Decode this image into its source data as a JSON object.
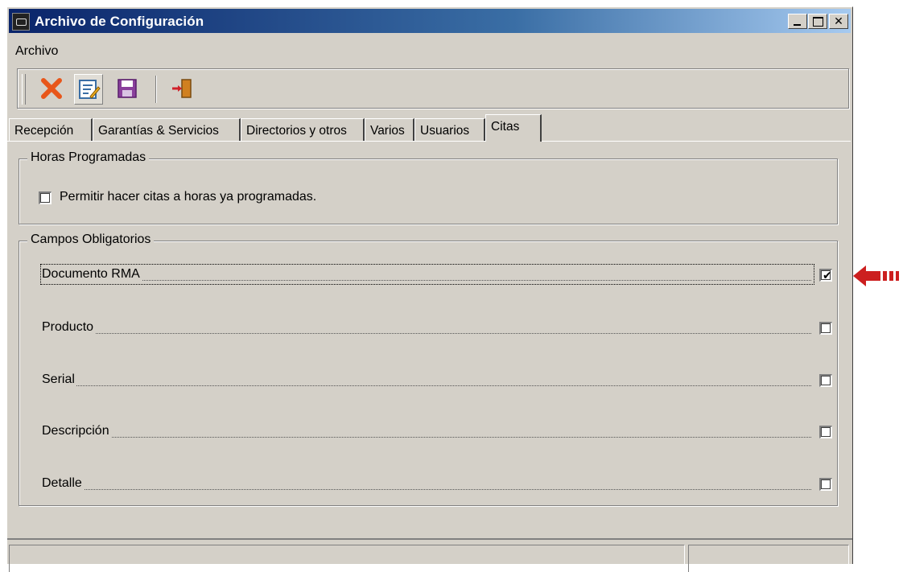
{
  "window": {
    "title": "Archivo de Configuración"
  },
  "menu": {
    "items": [
      "Archivo"
    ]
  },
  "toolbar": {
    "buttons": [
      {
        "icon": "delete-x-icon"
      },
      {
        "icon": "edit-document-icon"
      },
      {
        "icon": "save-disk-icon"
      },
      {
        "icon": "exit-door-icon"
      }
    ]
  },
  "tabs": [
    {
      "label": "Recepción"
    },
    {
      "label": "Garantías & Servicios"
    },
    {
      "label": "Directorios y otros"
    },
    {
      "label": "Varios"
    },
    {
      "label": "Usuarios"
    },
    {
      "label": "Citas",
      "active": true
    }
  ],
  "horas": {
    "legend": "Horas Programadas",
    "checkbox_label": "Permitir hacer citas a horas ya programadas.",
    "checked": false
  },
  "campos": {
    "legend": "Campos Obligatorios",
    "fields": [
      {
        "label": "Documento RMA",
        "checked": true
      },
      {
        "label": "Producto",
        "checked": false
      },
      {
        "label": "Serial",
        "checked": false
      },
      {
        "label": "Descripción",
        "checked": false
      },
      {
        "label": "Detalle",
        "checked": false
      }
    ]
  },
  "colors": {
    "titlebar": "#0a246a",
    "arrow": "#cc1f1f",
    "face": "#d4d0c8"
  }
}
